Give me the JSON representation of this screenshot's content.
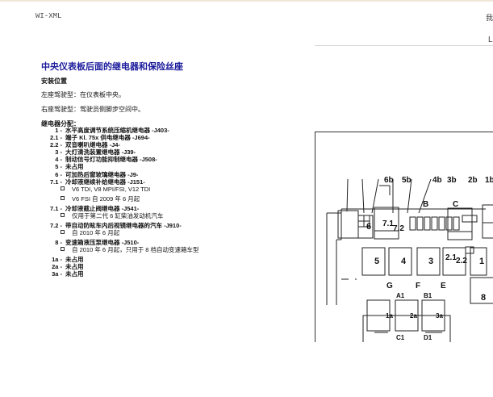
{
  "header": {
    "left": "WI-XML",
    "right": "我",
    "right2": "L"
  },
  "title": "中央仪表板后面的继电器和保险丝座",
  "install": {
    "heading": "安装位置",
    "lhd": "左座驾驶型：在仪表板中央。",
    "rhd": "右座驾驶型：驾驶员侧脚步空间中。"
  },
  "relays": {
    "heading": "继电器分配：",
    "items": [
      {
        "num": "1 -",
        "text": "水平高度调节系统压缩机继电器 -J403-"
      },
      {
        "num": "2.1 -",
        "text": "端子 Kl. 75x 供电继电器 -J694-"
      },
      {
        "num": "2.2 -",
        "text": "双音喇叭继电器 -J4-"
      },
      {
        "num": "3 -",
        "text": "大灯清洗装置继电器 -J39-"
      },
      {
        "num": "4 -",
        "text": "制动信号灯功能抑制继电器 -J508-"
      },
      {
        "num": "5 -",
        "text": "未占用"
      },
      {
        "num": "6 -",
        "text": "可加热后窗玻璃继电器 -J9-"
      },
      {
        "num": "7.1 -",
        "text": "冷却液继续补给继电器 -J151-",
        "subs": [
          "V6 TDI, V8 MPI/FSI, V12 TDI",
          "V6 FSI 自 2009 年 6 月起"
        ]
      },
      {
        "num": "7.1 -",
        "text": "冷却液截止阀继电器 -J541-",
        "subs": [
          "仅用于第二代 6 缸柴油发动机汽车"
        ]
      },
      {
        "num": "7.2 -",
        "text": "带自动防眩车内后视镜继电器的汽车 -J910-",
        "subs": [
          "自 2010 年 6 月起"
        ]
      },
      {
        "num": "8 -",
        "text": "变速箱液压泵继电器 -J510-",
        "subs": [
          "自 2010 年 6 月起，只用于 8 档自动变速箱车型"
        ]
      },
      {
        "num": "1a -",
        "text": "未占用"
      },
      {
        "num": "2a -",
        "text": "未占用"
      },
      {
        "num": "3a -",
        "text": "未占用"
      }
    ]
  },
  "diagram": {
    "callouts": [
      "6b",
      "5b",
      "4b",
      "3b",
      "2b",
      "1b"
    ],
    "letters": {
      "B": "B",
      "C": "C",
      "G": "G",
      "F": "F",
      "E": "E",
      "A1": "A1",
      "B1": "B1",
      "C1": "C1",
      "D1": "D1"
    },
    "relays": {
      "r6": "6",
      "r71": "7.1",
      "r72": "7.2",
      "r5": "5",
      "r4": "4",
      "r3": "3",
      "r21": "2.1",
      "r22": "2.2",
      "r1": "1",
      "r8": "8",
      "r1a": "1a",
      "r2a": "2a",
      "r3a": "3a"
    }
  }
}
